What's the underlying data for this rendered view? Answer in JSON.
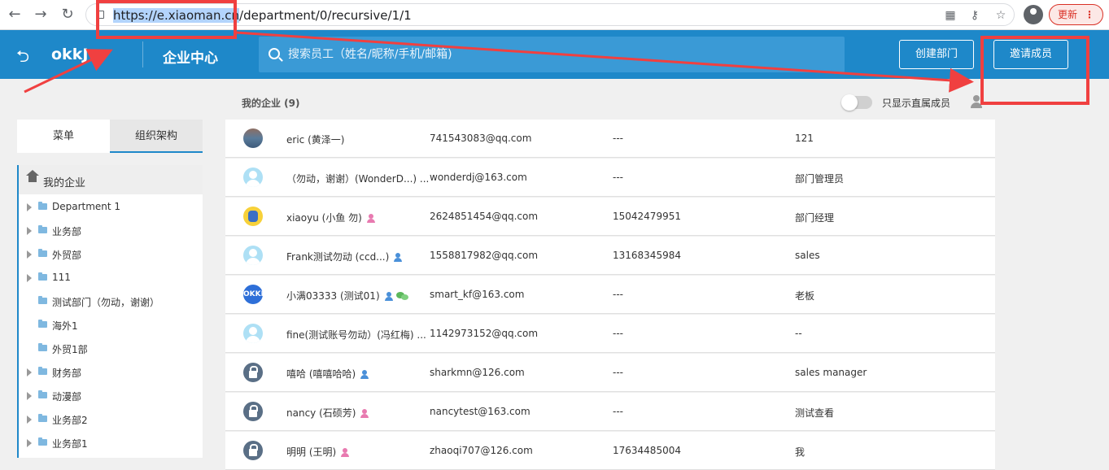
{
  "browser": {
    "url_selected": "https://e.xiaoman.cn",
    "url_rest": "/department/0/recursive/1/1",
    "update_label": "更新",
    "update_dots": "⋮"
  },
  "header": {
    "logo": "okkJ",
    "title": "企业中心",
    "search_placeholder": "搜索员工（姓名/昵称/手机/邮箱)",
    "create_dept_label": "创建部门",
    "invite_label": "邀请成员",
    "accent_color": "#1e88c9"
  },
  "sidebar": {
    "tabs": [
      {
        "label": "菜单"
      },
      {
        "label": "组织架构"
      }
    ],
    "root_label": "我的企业",
    "items": [
      {
        "label": "Department 1",
        "expandable": true
      },
      {
        "label": "业务部",
        "expandable": true
      },
      {
        "label": "外贸部",
        "expandable": true
      },
      {
        "label": "111",
        "expandable": true
      },
      {
        "label": "测试部门（勿动，谢谢）",
        "expandable": false
      },
      {
        "label": "海外1",
        "expandable": false
      },
      {
        "label": "外贸1部",
        "expandable": false
      },
      {
        "label": "财务部",
        "expandable": true
      },
      {
        "label": "动漫部",
        "expandable": true
      },
      {
        "label": "业务部2",
        "expandable": true
      },
      {
        "label": "业务部1",
        "expandable": true
      }
    ]
  },
  "main": {
    "title": "我的企业 (9)",
    "toggle_label": "只显示直属成员",
    "members": [
      {
        "name": "eric (黄泽一)",
        "email": "741543083@qq.com",
        "phone": "---",
        "role": "121",
        "avatar": "photo",
        "badge": ""
      },
      {
        "name": "（勿动，谢谢）(WonderD...) ...",
        "email": "wonderdj@163.com",
        "phone": "---",
        "role": "部门管理员",
        "avatar": "default",
        "badge": ""
      },
      {
        "name": "xiaoyu (小鱼 勿)",
        "email": "2624851454@qq.com",
        "phone": "15042479951",
        "role": "部门经理",
        "avatar": "yellow",
        "badge": "female"
      },
      {
        "name": "Frank测试勿动 (ccd...)",
        "email": "1558817982@qq.com",
        "phone": "13168345984",
        "role": "sales",
        "avatar": "default",
        "badge": "male"
      },
      {
        "name": "小满03333 (测试01)",
        "email": "smart_kf@163.com",
        "phone": "---",
        "role": "老板",
        "avatar": "okki",
        "badge": "male-wechat"
      },
      {
        "name": "fine(测试账号勿动）(冯红梅) ...",
        "email": "1142973152@qq.com",
        "phone": "---",
        "role": "--",
        "avatar": "default",
        "badge": ""
      },
      {
        "name": "嘻哈 (嘻嘻哈哈)",
        "email": "sharkmn@126.com",
        "phone": "---",
        "role": "sales manager",
        "avatar": "locked",
        "badge": "male"
      },
      {
        "name": "nancy (石硕芳)",
        "email": "nancytest@163.com",
        "phone": "---",
        "role": "测试查看",
        "avatar": "locked",
        "badge": "female"
      },
      {
        "name": "明明 (王明)",
        "email": "zhaoqi707@126.com",
        "phone": "17634485004",
        "role": "我",
        "avatar": "locked",
        "badge": "female"
      }
    ]
  }
}
